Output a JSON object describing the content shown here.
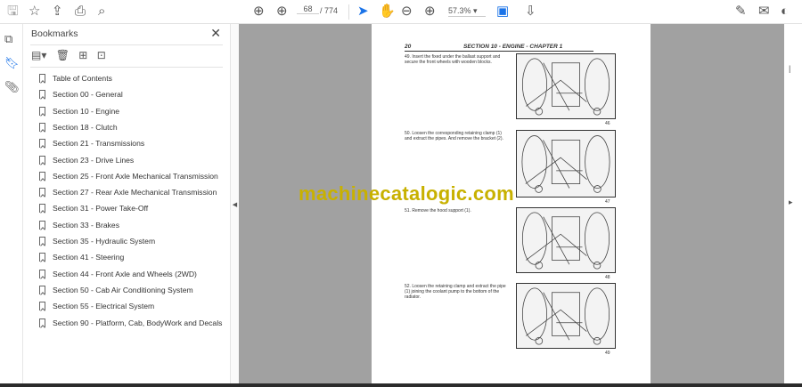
{
  "toolbar": {
    "page_current": "68",
    "page_total": "/ 774",
    "zoom": "57.3%"
  },
  "bookmarks": {
    "title": "Bookmarks",
    "items": [
      "Table of Contents",
      "Section 00 - General",
      "Section 10 - Engine",
      "Section 18 - Clutch",
      "Section 21 - Transmissions",
      "Section 23 - Drive Lines",
      "Section 25 - Front Axle Mechanical Transmission",
      "Section 27 - Rear Axle Mechanical Transmission",
      "Section 31 - Power Take-Off",
      "Section 33 - Brakes",
      "Section 35 - Hydraulic System",
      "Section 41 - Steering",
      "Section 44 - Front Axle and Wheels (2WD)",
      "Section 50 - Cab Air Conditioning System",
      "Section 55 - Electrical System",
      "Section 90 - Platform, Cab, BodyWork and Decals"
    ]
  },
  "document": {
    "page_number": "20",
    "header": "SECTION 10 - ENGINE - CHAPTER 1",
    "steps": [
      {
        "text": "49. Insert the fixed under the ballast support and secure the front wheels with wooden blocks.",
        "figure": "46"
      },
      {
        "text": "50. Loosen the corresponding retaining clamp (1) and extract the pipes. And remove the bracket (2).",
        "figure": "47"
      },
      {
        "text": "51. Remove the hood support (1).",
        "figure": "48"
      },
      {
        "text": "52. Loosen the retaining clamp and extract the pipe (1) joining the coolant pump to the bottom of the radiator.",
        "figure": "49"
      }
    ]
  },
  "watermark": "machinecatalogic.com"
}
